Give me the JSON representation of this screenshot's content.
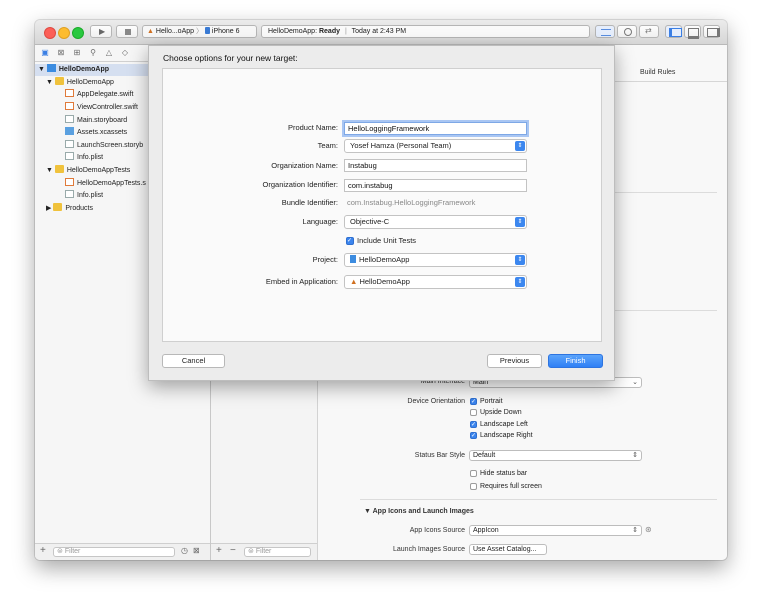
{
  "toolbar": {
    "scheme_app": "Hello...oApp",
    "scheme_device": "iPhone 6",
    "status_app": "HelloDemoApp:",
    "status_state": "Ready",
    "status_sep": "|",
    "status_time": "Today at 2:43 PM"
  },
  "navigator": {
    "items": [
      {
        "label": "HelloDemoApp",
        "icon": "project-icon"
      },
      {
        "label": "HelloDemoApp",
        "icon": "folder-icon"
      },
      {
        "label": "AppDelegate.swift",
        "icon": "swift-file-icon"
      },
      {
        "label": "ViewController.swift",
        "icon": "swift-file-icon"
      },
      {
        "label": "Main.storyboard",
        "icon": "storyboard-icon"
      },
      {
        "label": "Assets.xcassets",
        "icon": "assets-icon"
      },
      {
        "label": "LaunchScreen.storyb",
        "icon": "storyboard-icon"
      },
      {
        "label": "Info.plist",
        "icon": "plist-icon"
      },
      {
        "label": "HelloDemoAppTests",
        "icon": "folder-icon"
      },
      {
        "label": "HelloDemoAppTests.s",
        "icon": "swift-file-icon"
      },
      {
        "label": "Info.plist",
        "icon": "plist-icon"
      },
      {
        "label": "Products",
        "icon": "folder-icon"
      }
    ],
    "filter_placeholder": "Filter"
  },
  "middle": {
    "filter_placeholder": "Filter"
  },
  "editor": {
    "build_rules_tab": "Build Rules",
    "main_interface_label": "Main Interface",
    "main_interface_value": "Main",
    "device_orientation_label": "Device Orientation",
    "orientations": [
      {
        "label": "Portrait",
        "checked": true
      },
      {
        "label": "Upside Down",
        "checked": false
      },
      {
        "label": "Landscape Left",
        "checked": true
      },
      {
        "label": "Landscape Right",
        "checked": true
      }
    ],
    "status_bar_style_label": "Status Bar Style",
    "status_bar_style_value": "Default",
    "hide_status_bar": "Hide status bar",
    "requires_full_screen": "Requires full screen",
    "section_title": "App Icons and Launch Images",
    "app_icons_source_label": "App Icons Source",
    "app_icons_source_value": "AppIcon",
    "launch_images_source_label": "Launch Images Source",
    "launch_images_button": "Use Asset Catalog..."
  },
  "sheet": {
    "title": "Choose options for your new target:",
    "product_name_label": "Product Name:",
    "product_name_value": "HelloLoggingFramework",
    "team_label": "Team:",
    "team_value": "Yosef Hamza (Personal Team)",
    "org_name_label": "Organization Name:",
    "org_name_value": "Instabug",
    "org_id_label": "Organization Identifier:",
    "org_id_value": "com.instabug",
    "bundle_id_label": "Bundle Identifier:",
    "bundle_id_value": "com.Instabug.HelloLoggingFramework",
    "language_label": "Language:",
    "language_value": "Objective-C",
    "include_unit_tests": "Include Unit Tests",
    "project_label": "Project:",
    "project_value": "HelloDemoApp",
    "embed_label": "Embed in Application:",
    "embed_value": "HelloDemoApp",
    "cancel": "Cancel",
    "previous": "Previous",
    "finish": "Finish"
  }
}
